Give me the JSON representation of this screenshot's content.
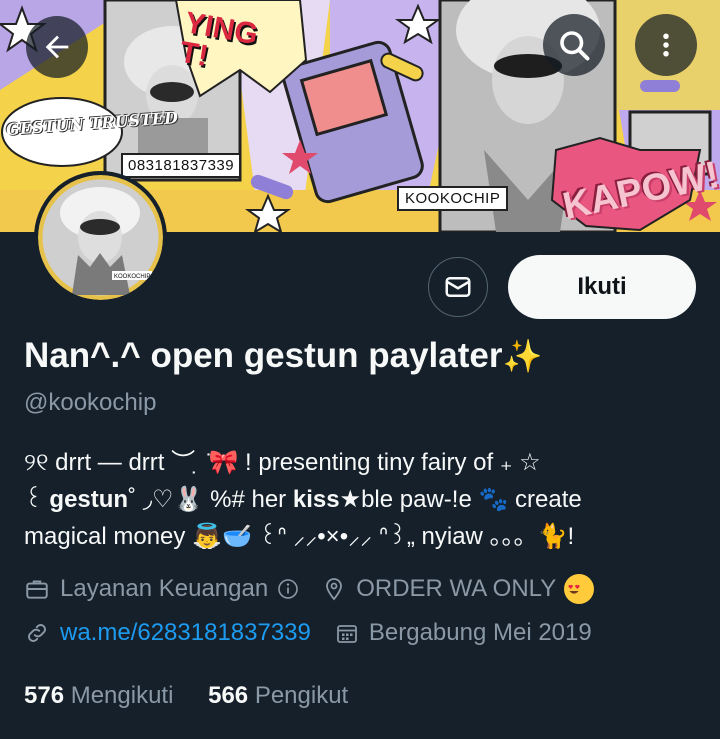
{
  "banner": {
    "phone_label": "083181837339",
    "kooko_label": "KOOKOCHIP",
    "kapow_text": "KAPOW!",
    "comic_text": "YING\nT!",
    "sticker_text": "GESTUN TRUSTED"
  },
  "nav": {
    "back_icon": "arrow-left-icon",
    "search_icon": "search-icon",
    "more_icon": "more-vertical-icon"
  },
  "actions": {
    "follow_label": "Ikuti",
    "message_icon": "envelope-icon"
  },
  "profile": {
    "display_name": "Nan^.^ open gestun paylater",
    "display_emoji": "✨",
    "handle": "@kookochip",
    "bio": {
      "line1_a": "୨୧ drrt — drrt ︶ ̣ ̇",
      "line1_ribbon": "🎀",
      "line1_b": " ! presenting tiny fairy of ₊ ☆",
      "line2_a": "꒰ ",
      "line2_bold1": "gestun",
      "line2_b": "˚ ◞♡",
      "line2_rabbit": "🐰",
      "line2_c": " %# her ",
      "line2_bold2": "kiss★",
      "line2_d": "ble paw-!e ",
      "line2_paw": "🐾",
      "line2_e": " create",
      "line3_a": "magical money ",
      "line3_angel": "👼",
      "line3_bowl": "🥣",
      "line3_b": " ꒰ᐢ ⸝⸝•×•⸝⸝ ᐢ꒱„ nyiaw 。。。",
      "line3_cat": "🐈",
      "line3_c": "!"
    },
    "category": "Layanan Keuangan",
    "location": "ORDER WA ONLY",
    "location_emoji": "😍",
    "link": "wa.me/6283181837339",
    "joined": "Bergabung Mei 2019",
    "following_count": "576",
    "following_label": "Mengikuti",
    "followers_count": "566",
    "followers_label": "Pengikut"
  },
  "colors": {
    "background": "#15202b",
    "text": "#f7f9f9",
    "muted": "#8b98a5",
    "link": "#1d9bf0",
    "banner_yellow": "#f4d24a"
  }
}
